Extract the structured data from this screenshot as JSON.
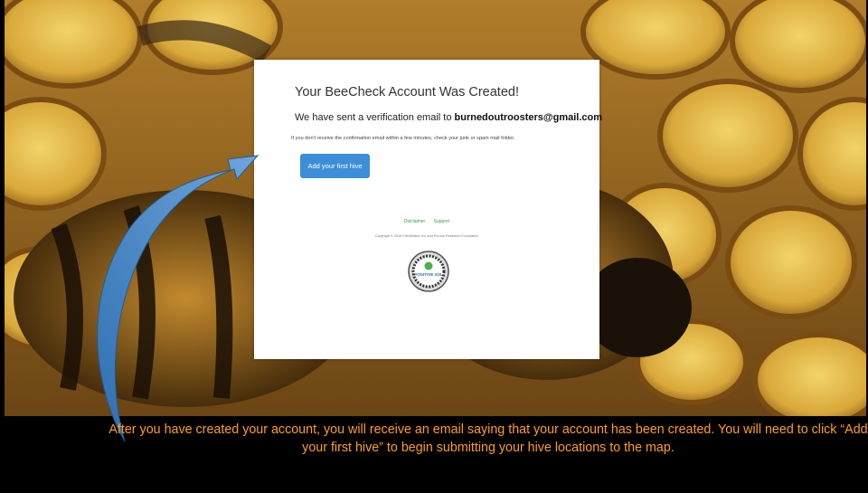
{
  "card": {
    "title": "Your BeeCheck Account Was Created!",
    "sent_prefix": "We have sent a verification email to ",
    "email": "burnedoutroosters@gmail.com",
    "note": "If you don't receive the confirmation email within a few minutes, check your junk or spam mail folder.",
    "button_label": "Add your first hive",
    "footer_links": [
      "Disclaimer",
      "Support"
    ],
    "copyright": "Copyright © 2016 FieldWatch, Inc and Purdue Research Foundation",
    "seal": {
      "badge_text": "POSITIVE SSL"
    }
  },
  "caption": "After you have created your account, you will receive an email saying that your account has been created.  You will need to click “Add your first hive” to begin submitting your hive locations to the map.",
  "colors": {
    "caption": "#ff9f1a",
    "button": "#3d8ed9",
    "link": "#3a9a4a",
    "arrow": "#4a86c6"
  },
  "icons": [
    "honeycomb-background",
    "bee-image",
    "ssl-seal-icon",
    "curved-arrow-icon"
  ]
}
